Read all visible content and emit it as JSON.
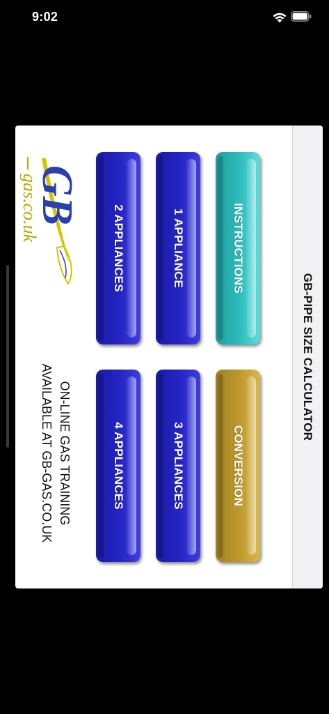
{
  "status_bar": {
    "time": "9:02"
  },
  "app": {
    "title": "GB-PIPE SIZE CALCULATOR",
    "buttons": {
      "instructions": "INSTRUCTIONS",
      "conversion": "CONVERSION",
      "one_appliance": "1 APPLIANCE",
      "three_appliances": "3 APPLIANCES",
      "two_appliances": "2 APPLIANCES",
      "four_appliances": "4 APPLIANCES"
    },
    "logo": {
      "letters": "GB",
      "domain": "gas.co.uk"
    },
    "promo": {
      "line1": "ON-LINE GAS TRAINING",
      "line2": "AVAILABLE AT GB-GAS.CO.UK"
    }
  },
  "colors": {
    "blue_button": "#2525c4",
    "teal_button": "#2fbdbd",
    "gold_button": "#bf9a2e",
    "logo_blue": "#2a3fb0",
    "logo_yellow": "#d8c400"
  },
  "icons": {
    "wifi": "wifi-icon",
    "battery": "battery-icon"
  }
}
